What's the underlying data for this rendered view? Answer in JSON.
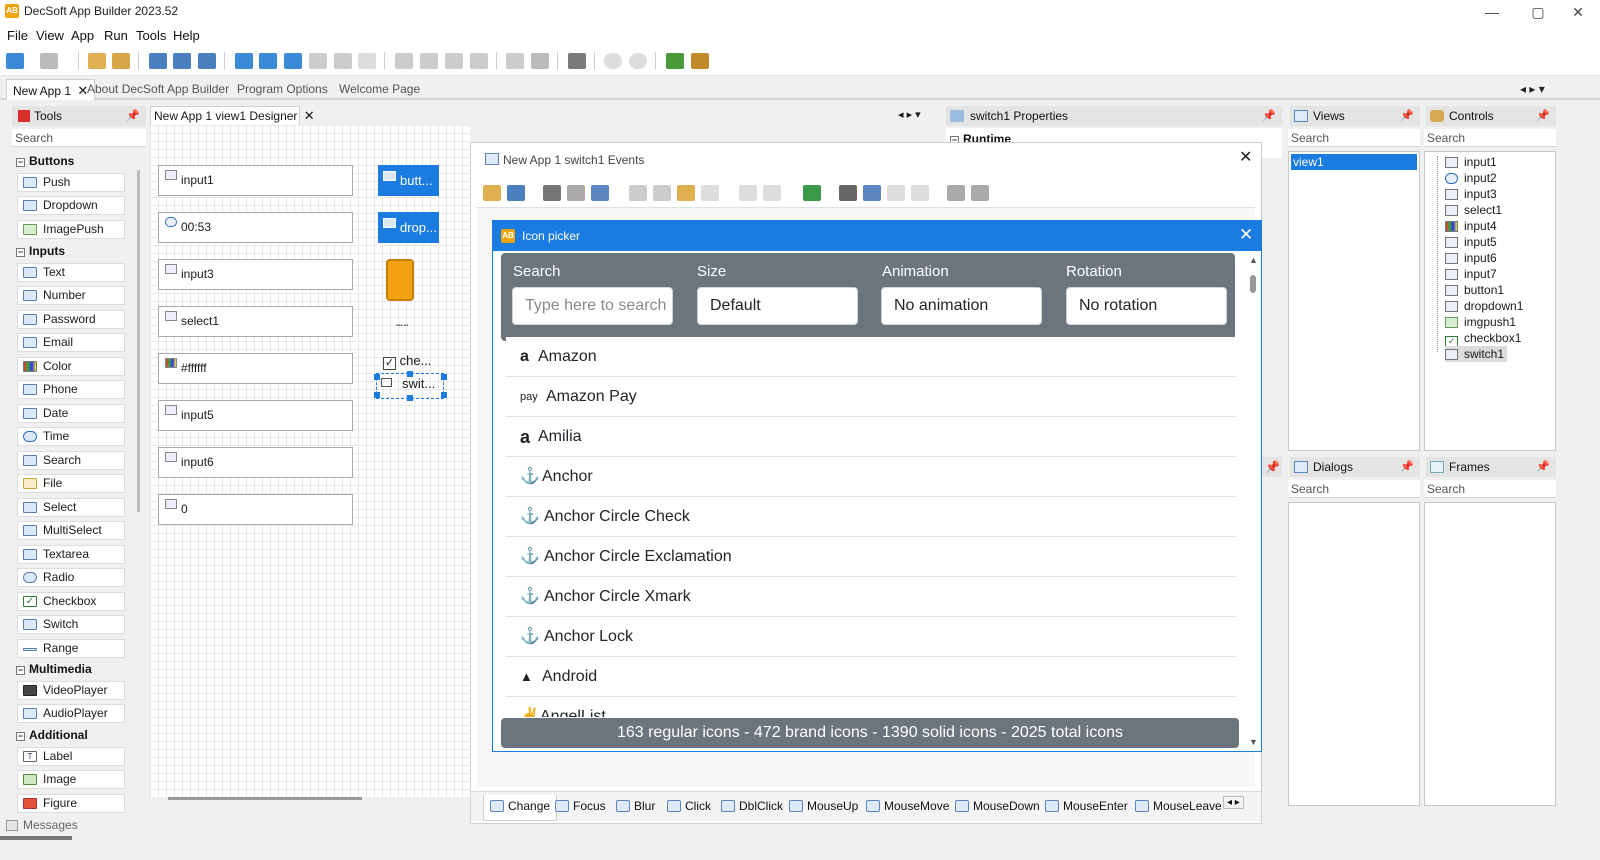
{
  "window": {
    "title": "DecSoft App Builder 2023.52",
    "icon": "AB"
  },
  "menu": [
    "File",
    "View",
    "App",
    "Run",
    "Tools",
    "Help"
  ],
  "doc_tabs": {
    "active": "New App 1",
    "others": [
      "About DecSoft App Builder",
      "Program Options",
      "Welcome Page"
    ]
  },
  "tools_panel": {
    "title": "Tools",
    "search": "Search",
    "sections": [
      {
        "name": "Buttons",
        "items": [
          "Push",
          "Dropdown",
          "ImagePush"
        ]
      },
      {
        "name": "Inputs",
        "items": [
          "Text",
          "Number",
          "Password",
          "Email",
          "Color",
          "Phone",
          "Date",
          "Time",
          "Search",
          "File",
          "Select",
          "MultiSelect",
          "Textarea",
          "Radio",
          "Checkbox",
          "Switch",
          "Range"
        ]
      },
      {
        "name": "Multimedia",
        "items": [
          "VideoPlayer",
          "AudioPlayer"
        ]
      },
      {
        "name": "Additional",
        "items": [
          "Label",
          "Image",
          "Figure"
        ]
      }
    ]
  },
  "designer": {
    "tab": "New App 1 view1 Designer",
    "fields": [
      "input1",
      "00:53",
      "input3",
      "select1",
      "#ffffff",
      "input5",
      "input6",
      "0"
    ],
    "buttons": [
      "butt...",
      "drop..."
    ],
    "checks": [
      "che...",
      "swit..."
    ]
  },
  "properties": {
    "title": "switch1 Properties",
    "section": "Runtime"
  },
  "events": {
    "title": "New App 1 switch1 Events",
    "tabs": [
      "Change",
      "Focus",
      "Blur",
      "Click",
      "DblClick",
      "MouseUp",
      "MouseMove",
      "MouseDown",
      "MouseEnter",
      "MouseLeave"
    ]
  },
  "icon_picker": {
    "title": "Icon picker",
    "filters": {
      "search": {
        "label": "Search",
        "placeholder": "Type here to search"
      },
      "size": {
        "label": "Size",
        "value": "Default"
      },
      "animation": {
        "label": "Animation",
        "value": "No animation"
      },
      "rotation": {
        "label": "Rotation",
        "value": "No rotation"
      }
    },
    "icons": [
      {
        "glyph": "a",
        "name": "Amazon"
      },
      {
        "glyph": "pay",
        "name": "Amazon Pay"
      },
      {
        "glyph": "a",
        "name": "Amilia"
      },
      {
        "glyph": "⚓",
        "name": "Anchor"
      },
      {
        "glyph": "⚓",
        "name": "Anchor Circle Check"
      },
      {
        "glyph": "⚓",
        "name": "Anchor Circle Exclamation"
      },
      {
        "glyph": "⚓",
        "name": "Anchor Circle Xmark"
      },
      {
        "glyph": "⚓",
        "name": "Anchor Lock"
      },
      {
        "glyph": "▲",
        "name": "Android"
      },
      {
        "glyph": "✌",
        "name": "AngelList"
      }
    ],
    "footer": "163 regular icons - 472 brand icons - 1390 solid icons - 2025 total icons"
  },
  "views_panel": {
    "title": "Views",
    "search": "Search",
    "items": [
      "view1"
    ]
  },
  "controls_panel": {
    "title": "Controls",
    "search": "Search",
    "items": [
      "input1",
      "input2",
      "input3",
      "select1",
      "input4",
      "input5",
      "input6",
      "input7",
      "button1",
      "dropdown1",
      "imgpush1",
      "checkbox1",
      "switch1"
    ],
    "selected": "switch1"
  },
  "dialogs_panel": {
    "title": "Dialogs",
    "search": "Search"
  },
  "frames_panel": {
    "title": "Frames",
    "search": "Search"
  },
  "status": {
    "messages": "Messages"
  },
  "colors": {
    "accent": "#1a7be0",
    "picker_bar": "#6c757d",
    "close_red": "#e81123"
  }
}
